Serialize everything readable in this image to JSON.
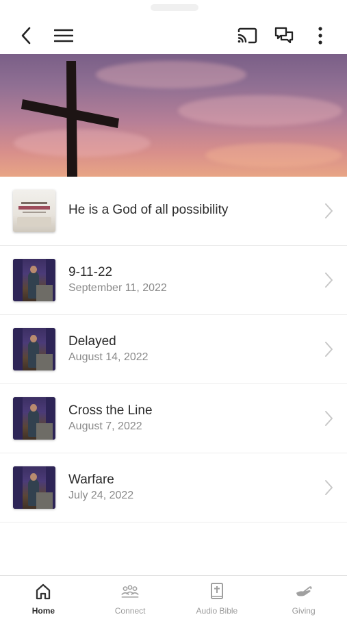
{
  "topbar": {
    "back_icon": "chevron-left-icon",
    "menu_icon": "hamburger-menu-icon",
    "cast_icon": "cast-icon",
    "chat_icon": "chat-bubbles-icon",
    "more_icon": "more-vertical-icon"
  },
  "hero": {
    "image": "cross-against-sunset-sky"
  },
  "sermons": [
    {
      "title": "He is a God of all possibility",
      "date": "",
      "thumb": "book"
    },
    {
      "title": "9-11-22",
      "date": "September 11, 2022",
      "thumb": "stage"
    },
    {
      "title": "Delayed",
      "date": "August 14, 2022",
      "thumb": "stage"
    },
    {
      "title": "Cross the Line",
      "date": "August 7, 2022",
      "thumb": "stage"
    },
    {
      "title": "Warfare",
      "date": "July 24, 2022",
      "thumb": "stage"
    }
  ],
  "tabs": [
    {
      "label": "Home",
      "icon": "home-icon",
      "active": true
    },
    {
      "label": "Connect",
      "icon": "people-icon",
      "active": false
    },
    {
      "label": "Audio Bible",
      "icon": "bible-icon",
      "active": false
    },
    {
      "label": "Giving",
      "icon": "giving-hand-icon",
      "active": false
    }
  ],
  "colors": {
    "text": "#2b2b2b",
    "muted": "#8a8a8a",
    "divider": "#ececec",
    "chevron": "#c8c8c8"
  }
}
